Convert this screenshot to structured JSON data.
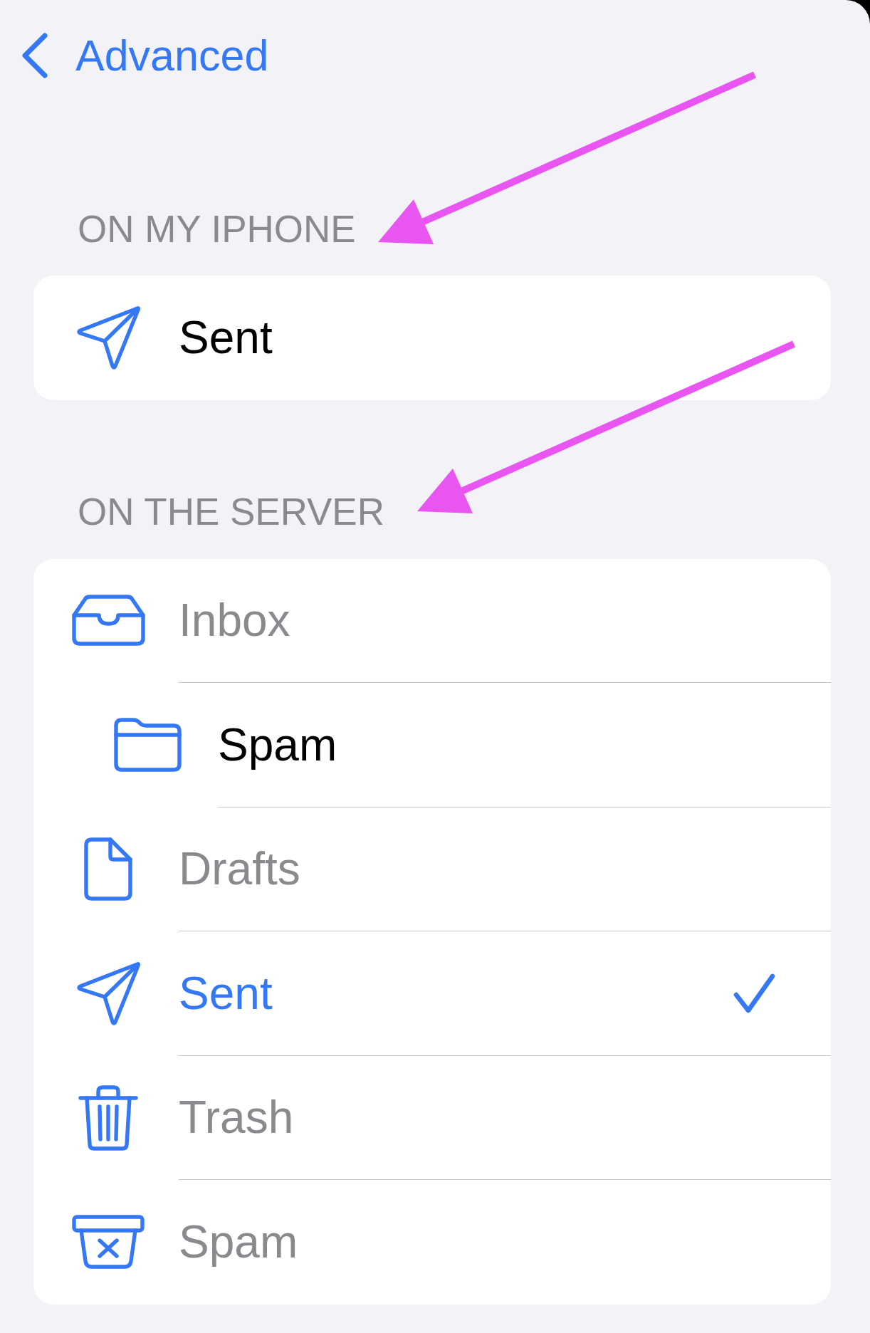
{
  "nav": {
    "back_label": "Advanced"
  },
  "sections": [
    {
      "header": "ON MY IPHONE",
      "arrow": true,
      "rows": [
        {
          "kind": "sent",
          "label": "Sent",
          "selected": false,
          "disabled": false
        }
      ]
    },
    {
      "header": "ON THE SERVER",
      "arrow": true,
      "rows": [
        {
          "kind": "inbox",
          "label": "Inbox",
          "selected": false,
          "disabled": true,
          "children": [
            {
              "kind": "folder",
              "label": "Spam",
              "selected": false,
              "disabled": false
            }
          ]
        },
        {
          "kind": "drafts",
          "label": "Drafts",
          "selected": false,
          "disabled": true
        },
        {
          "kind": "sent",
          "label": "Sent",
          "selected": true,
          "disabled": false
        },
        {
          "kind": "trash",
          "label": "Trash",
          "selected": false,
          "disabled": true
        },
        {
          "kind": "junk",
          "label": "Spam",
          "selected": false,
          "disabled": true
        }
      ]
    }
  ]
}
